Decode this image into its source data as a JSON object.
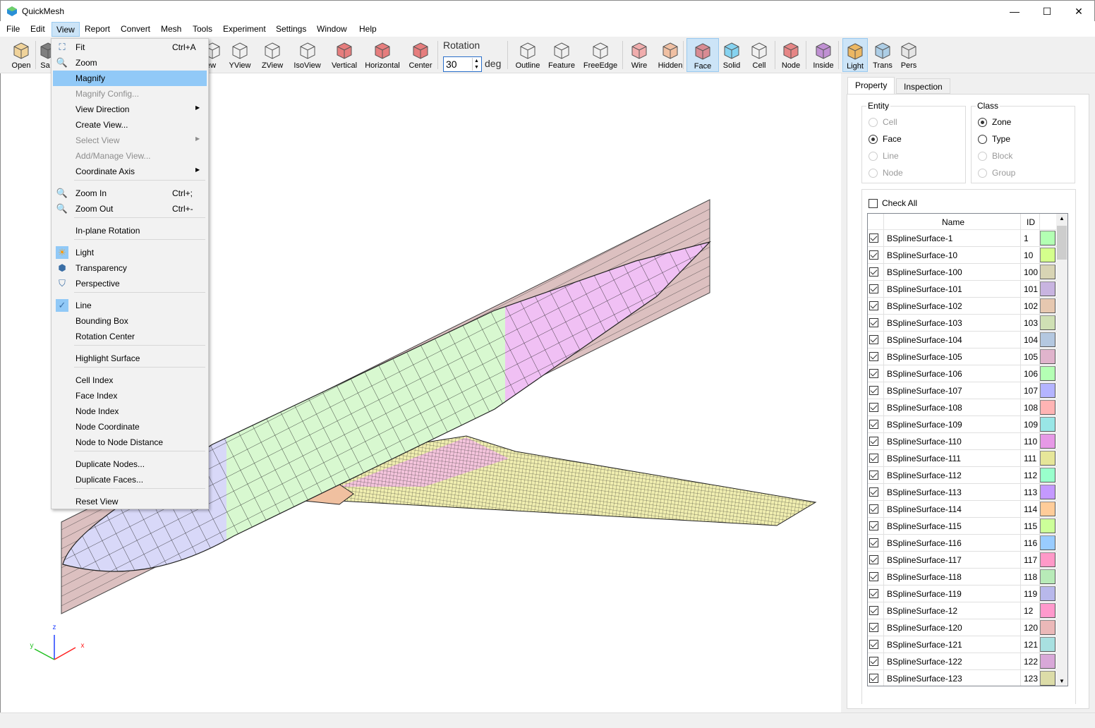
{
  "app": {
    "title": "QuickMesh"
  },
  "window_controls": {
    "minimize": "—",
    "maximize": "☐",
    "close": "✕"
  },
  "menubar": [
    "File",
    "Edit",
    "View",
    "Report",
    "Convert",
    "Mesh",
    "Tools",
    "Experiment",
    "Settings",
    "Window",
    "Help"
  ],
  "toolbar": {
    "buttons": [
      {
        "label": "Open",
        "icon": "folder-icon"
      },
      {
        "label": "Sa",
        "icon": "save-icon"
      },
      {
        "label": "ew",
        "icon": "xview-icon"
      },
      {
        "label": "YView",
        "icon": "yview-icon"
      },
      {
        "label": "ZView",
        "icon": "zview-icon"
      },
      {
        "label": "IsoView",
        "icon": "isoview-icon"
      },
      {
        "label": "Vertical",
        "icon": "vertical-rotate-icon"
      },
      {
        "label": "Horizontal",
        "icon": "horizontal-rotate-icon"
      },
      {
        "label": "Center",
        "icon": "center-icon"
      },
      {
        "label": "Outline",
        "icon": "outline-icon"
      },
      {
        "label": "Feature",
        "icon": "feature-icon"
      },
      {
        "label": "FreeEdge",
        "icon": "free-edge-icon"
      },
      {
        "label": "Wire",
        "icon": "wire-icon"
      },
      {
        "label": "Hidden",
        "icon": "hidden-icon"
      },
      {
        "label": "Face",
        "icon": "face-icon",
        "active": true
      },
      {
        "label": "Solid",
        "icon": "solid-icon"
      },
      {
        "label": "Cell",
        "icon": "cell-icon"
      },
      {
        "label": "Node",
        "icon": "node-icon"
      },
      {
        "label": "Inside",
        "icon": "inside-icon"
      },
      {
        "label": "Light",
        "icon": "light-icon",
        "active": true
      },
      {
        "label": "Trans",
        "icon": "transparency-icon"
      },
      {
        "label": "Pers",
        "icon": "perspective-icon"
      }
    ],
    "rotation": {
      "label": "Rotation",
      "value": "30",
      "unit": "deg"
    }
  },
  "view_menu": {
    "items": [
      {
        "label": "Fit",
        "shortcut": "Ctrl+A",
        "icon": "fit-icon"
      },
      {
        "label": "Zoom",
        "icon": "zoom-icon"
      },
      {
        "label": "Magnify",
        "highlighted": true
      },
      {
        "label": "Magnify Config...",
        "disabled": true
      },
      {
        "label": "View Direction",
        "submenu": true
      },
      {
        "label": "Create View..."
      },
      {
        "label": "Select View",
        "disabled": true,
        "submenu": true
      },
      {
        "label": "Add/Manage View...",
        "disabled": true
      },
      {
        "label": "Coordinate Axis",
        "submenu": true
      },
      {
        "label": "Zoom In",
        "shortcut": "Ctrl+;",
        "icon": "zoom-in-icon"
      },
      {
        "label": "Zoom Out",
        "shortcut": "Ctrl+-",
        "icon": "zoom-out-icon"
      },
      {
        "label": "In-plane Rotation"
      },
      {
        "label": "Light",
        "icon": "light-icon",
        "checked": true
      },
      {
        "label": "Transparency",
        "icon": "transparency-icon"
      },
      {
        "label": "Perspective",
        "icon": "perspective-icon"
      },
      {
        "label": "Line",
        "checked": true
      },
      {
        "label": "Bounding Box"
      },
      {
        "label": "Rotation Center"
      },
      {
        "label": "Highlight Surface"
      },
      {
        "label": "Cell Index"
      },
      {
        "label": "Face Index"
      },
      {
        "label": "Node Index"
      },
      {
        "label": "Node Coordinate"
      },
      {
        "label": "Node to Node Distance"
      },
      {
        "label": "Duplicate Nodes..."
      },
      {
        "label": "Duplicate Faces..."
      },
      {
        "label": "Reset View"
      }
    ]
  },
  "viewport": {
    "axes": {
      "x": "x",
      "y": "y",
      "z": "z"
    }
  },
  "panel": {
    "tabs": [
      {
        "label": "Property",
        "selected": true
      },
      {
        "label": "Inspection"
      }
    ],
    "entity": {
      "title": "Entity",
      "options": [
        {
          "label": "Cell",
          "disabled": true
        },
        {
          "label": "Face",
          "selected": true
        },
        {
          "label": "Line",
          "disabled": true
        },
        {
          "label": "Node",
          "disabled": true
        }
      ]
    },
    "class": {
      "title": "Class",
      "options": [
        {
          "label": "Zone",
          "selected": true
        },
        {
          "label": "Type"
        },
        {
          "label": "Block",
          "disabled": true
        },
        {
          "label": "Group",
          "disabled": true
        }
      ]
    },
    "check_all": {
      "label": "Check All",
      "checked": false
    },
    "table": {
      "columns": [
        "Name",
        "ID"
      ],
      "rows": [
        {
          "name": "BSplineSurface-1",
          "id": "1",
          "color": "#b3ffb3",
          "checked": true
        },
        {
          "name": "BSplineSurface-10",
          "id": "10",
          "color": "#d4ff8c",
          "checked": true
        },
        {
          "name": "BSplineSurface-100",
          "id": "100",
          "color": "#d8d4b4",
          "checked": true
        },
        {
          "name": "BSplineSurface-101",
          "id": "101",
          "color": "#c8b4e0",
          "checked": true
        },
        {
          "name": "BSplineSurface-102",
          "id": "102",
          "color": "#e6c8b0",
          "checked": true
        },
        {
          "name": "BSplineSurface-103",
          "id": "103",
          "color": "#cfe0b4",
          "checked": true
        },
        {
          "name": "BSplineSurface-104",
          "id": "104",
          "color": "#b4c8e0",
          "checked": true
        },
        {
          "name": "BSplineSurface-105",
          "id": "105",
          "color": "#e0b4cc",
          "checked": true
        },
        {
          "name": "BSplineSurface-106",
          "id": "106",
          "color": "#b4ffb4",
          "checked": true
        },
        {
          "name": "BSplineSurface-107",
          "id": "107",
          "color": "#b4b4ff",
          "checked": true
        },
        {
          "name": "BSplineSurface-108",
          "id": "108",
          "color": "#ffb4b4",
          "checked": true
        },
        {
          "name": "BSplineSurface-109",
          "id": "109",
          "color": "#99e6e6",
          "checked": true
        },
        {
          "name": "BSplineSurface-110",
          "id": "110",
          "color": "#e699e6",
          "checked": true
        },
        {
          "name": "BSplineSurface-111",
          "id": "111",
          "color": "#e6e699",
          "checked": true
        },
        {
          "name": "BSplineSurface-112",
          "id": "112",
          "color": "#99ffcc",
          "checked": true
        },
        {
          "name": "BSplineSurface-113",
          "id": "113",
          "color": "#c499ff",
          "checked": true
        },
        {
          "name": "BSplineSurface-114",
          "id": "114",
          "color": "#ffcc99",
          "checked": true
        },
        {
          "name": "BSplineSurface-115",
          "id": "115",
          "color": "#ccff99",
          "checked": true
        },
        {
          "name": "BSplineSurface-116",
          "id": "116",
          "color": "#99ccff",
          "checked": true
        },
        {
          "name": "BSplineSurface-117",
          "id": "117",
          "color": "#ff99c8",
          "checked": true
        },
        {
          "name": "BSplineSurface-118",
          "id": "118",
          "color": "#b8ebb8",
          "checked": true
        },
        {
          "name": "BSplineSurface-119",
          "id": "119",
          "color": "#b8b8eb",
          "checked": true
        },
        {
          "name": "BSplineSurface-12",
          "id": "12",
          "color": "#ff99cc",
          "checked": true
        },
        {
          "name": "BSplineSurface-120",
          "id": "120",
          "color": "#ebb8b8",
          "checked": true
        },
        {
          "name": "BSplineSurface-121",
          "id": "121",
          "color": "#a8e0e0",
          "checked": true
        },
        {
          "name": "BSplineSurface-122",
          "id": "122",
          "color": "#d8a8d8",
          "checked": true
        },
        {
          "name": "BSplineSurface-123",
          "id": "123",
          "color": "#dcdca8",
          "checked": true
        }
      ]
    }
  },
  "colors": {
    "accent": "#91c9f7",
    "active_button": "#cce4f7",
    "fuselage_nose": "#d8d8f8",
    "fuselage_mid": "#d8f8d0",
    "fuselage_tail": "#f0c0f4",
    "symmetry_plane": "#dcc0c0",
    "wing": "#f0eeb0"
  }
}
